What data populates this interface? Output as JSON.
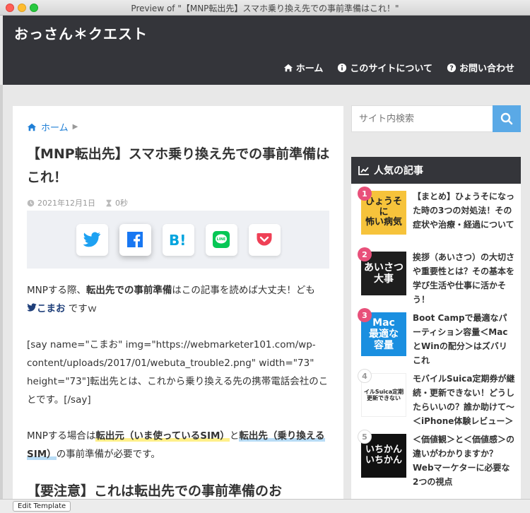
{
  "window": {
    "title": "Preview of \"【MNP転出先】スマホ乗り換え先での事前準備はこれ！\""
  },
  "header": {
    "site_title": "おっさん＊クエスト",
    "nav": [
      {
        "label": "ホーム",
        "icon": "home-icon"
      },
      {
        "label": "このサイトについて",
        "icon": "info-icon"
      },
      {
        "label": "お問い合わせ",
        "icon": "question-icon"
      }
    ]
  },
  "breadcrumb": {
    "home_label": "ホーム"
  },
  "article": {
    "title": "【MNP転出先】スマホ乗り換え先での事前準備はこれ！",
    "date": "2021年12月1日",
    "read_time": "0秒",
    "share_buttons": [
      "twitter",
      "facebook",
      "hatena",
      "line",
      "pocket"
    ],
    "p1_a": "MNPする際、",
    "p1_b": "転出先での事前準備",
    "p1_c": "はこの記事を読めば大丈夫！ども",
    "p1_link": "こまお",
    "p1_d": " ですｗ",
    "p2": "[say name=\"こまお\" img=\"https://webmarketer101.com/wp-content/uploads/2017/01/webuta_trouble2.png\" width=\"73\" height=\"73\"]転出先とは、これから乗り換える先の携帯電話会社のことです。[/say]",
    "p3_a": "MNPする場合は",
    "p3_b": "転出元（いま使っているSIM）",
    "p3_c": "と",
    "p3_d": "転出先（乗り換えるSIM）",
    "p3_e": "の事前準備が必要です。",
    "h2": "【要注意】これは転出先での事前準備のお"
  },
  "sidebar": {
    "search_placeholder": "サイト内検索",
    "popular_title": "人気の記事",
    "items": [
      {
        "rank": "1",
        "title": "【まとめ】ひょうそになった時の3つの対処法！その症状や治療・経過について",
        "thumb": "ひょうそに\n怖い病気"
      },
      {
        "rank": "2",
        "title": "挨拶（あいさつ）の大切さや重要性とは？その基本を学び生活や仕事に活かそう！",
        "thumb": "あいさつ\n大事"
      },
      {
        "rank": "3",
        "title": "Boot Campで最適なパーティション容量＜MacとWinの配分＞はズバリこれ",
        "thumb": "Mac\n最適な\n容量"
      },
      {
        "rank": "4",
        "title": "モバイルSuica定期券が継続・更新できない！どうしたらいいの？誰か助けて〜＜iPhone体験レビュー＞",
        "thumb": "イルSuica定期\n更新できない"
      },
      {
        "rank": "5",
        "title": "＜価値観＞と＜価値感＞の違いがわかりますか？Webマーケターに必要な2つの視点",
        "thumb": "いちかん\nいちかん"
      }
    ]
  },
  "footer": {
    "edit_template_label": "Edit Template"
  },
  "colors": {
    "header_bg": "#34353a",
    "accent_blue": "#5aa9e6",
    "rank_pink": "#e8507a"
  }
}
